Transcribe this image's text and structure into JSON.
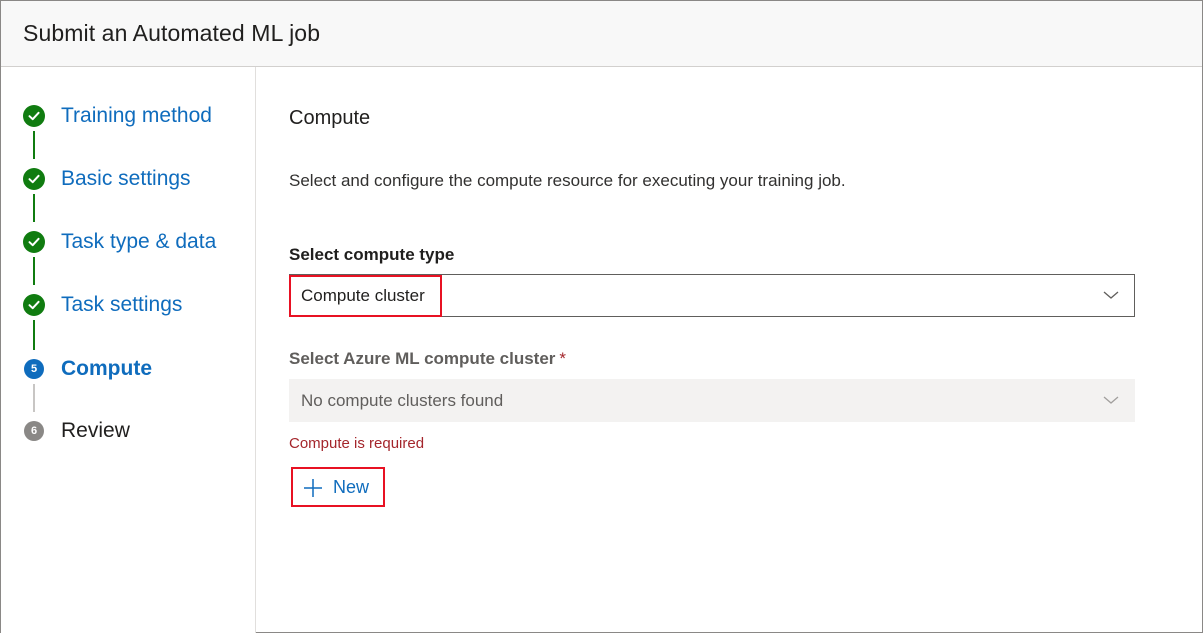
{
  "window": {
    "title": "Submit an Automated ML job"
  },
  "steps": [
    {
      "label": "Training method",
      "state": "done",
      "icon": "checkmark-circle-icon"
    },
    {
      "label": "Basic settings",
      "state": "done",
      "icon": "checkmark-circle-icon"
    },
    {
      "label": "Task type & data",
      "state": "done",
      "icon": "checkmark-circle-icon"
    },
    {
      "label": "Task settings",
      "state": "done",
      "icon": "checkmark-circle-icon"
    },
    {
      "label": "Compute",
      "state": "current",
      "number": "5"
    },
    {
      "label": "Review",
      "state": "pending",
      "number": "6"
    }
  ],
  "main": {
    "section_title": "Compute",
    "description": "Select and configure the compute resource for executing your training job.",
    "compute_type": {
      "label": "Select compute type",
      "value": "Compute cluster"
    },
    "cluster": {
      "label": "Select Azure ML compute cluster",
      "required_marker": "*",
      "value": "No compute clusters found",
      "error": "Compute is required"
    },
    "new_button": {
      "label": "New",
      "icon": "plus-icon"
    }
  },
  "colors": {
    "accent": "#0f6cbd",
    "done": "#107c10",
    "error": "#a4262c",
    "highlight": "#e81123"
  }
}
